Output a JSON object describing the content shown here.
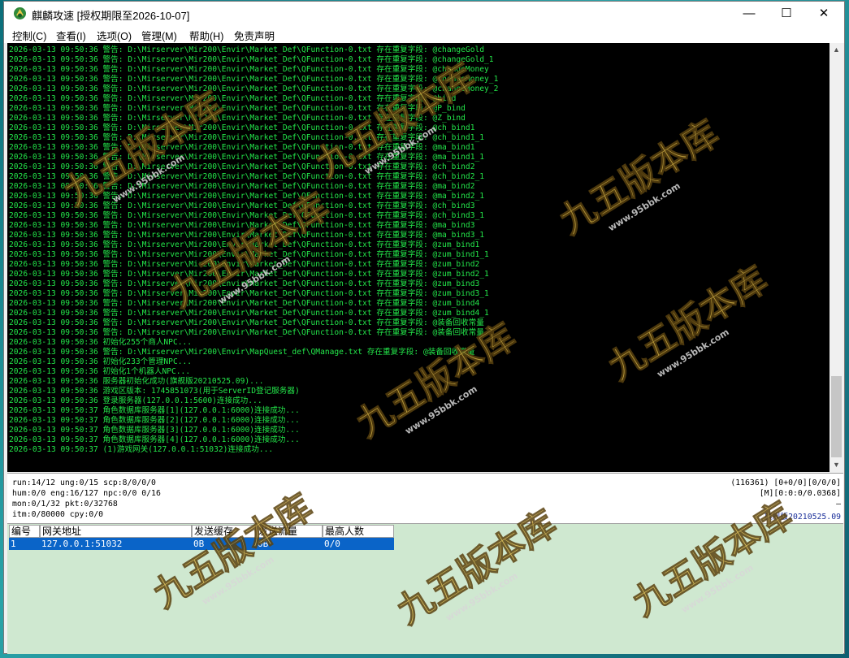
{
  "window": {
    "title": "麒麟攻速 [授权期限至2026-10-07]",
    "minimize_glyph": "—",
    "maximize_glyph": "☐",
    "close_glyph": "✕"
  },
  "menu": [
    "控制(C)",
    "查看(I)",
    "选项(O)",
    "管理(M)",
    "帮助(H)",
    "免责声明"
  ],
  "log": [
    "2026-03-13 09:50:36 警告: D:\\Mirserver\\Mir200\\Envir\\Market_Def\\QFunction-0.txt 存在重复字段: @changeGold",
    "2026-03-13 09:50:36 警告: D:\\Mirserver\\Mir200\\Envir\\Market_Def\\QFunction-0.txt 存在重复字段: @changeGold_1",
    "2026-03-13 09:50:36 警告: D:\\Mirserver\\Mir200\\Envir\\Market_Def\\QFunction-0.txt 存在重复字段: @changeMoney",
    "2026-03-13 09:50:36 警告: D:\\Mirserver\\Mir200\\Envir\\Market_Def\\QFunction-0.txt 存在重复字段: @changeMoney_1",
    "2026-03-13 09:50:36 警告: D:\\Mirserver\\Mir200\\Envir\\Market_Def\\QFunction-0.txt 存在重复字段: @changeMoney_2",
    "2026-03-13 09:50:36 警告: D:\\Mirserver\\Mir200\\Envir\\Market_Def\\QFunction-0.txt 存在重复字段: @bind",
    "2026-03-13 09:50:36 警告: D:\\Mirserver\\Mir200\\Envir\\Market_Def\\QFunction-0.txt 存在重复字段: @P_bind",
    "2026-03-13 09:50:36 警告: D:\\Mirserver\\Mir200\\Envir\\Market_Def\\QFunction-0.txt 存在重复字段: @Z_bind",
    "2026-03-13 09:50:36 警告: D:\\Mirserver\\Mir200\\Envir\\Market_Def\\QFunction-0.txt 存在重复字段: @ch_bind1",
    "2026-03-13 09:50:36 警告: D:\\Mirserver\\Mir200\\Envir\\Market_Def\\QFunction-0.txt 存在重复字段: @ch_bind1_1",
    "2026-03-13 09:50:36 警告: D:\\Mirserver\\Mir200\\Envir\\Market_Def\\QFunction-0.txt 存在重复字段: @ma_bind1",
    "2026-03-13 09:50:36 警告: D:\\Mirserver\\Mir200\\Envir\\Market_Def\\QFunction-0.txt 存在重复字段: @ma_bind1_1",
    "2026-03-13 09:50:36 警告: D:\\Mirserver\\Mir200\\Envir\\Market_Def\\QFunction-0.txt 存在重复字段: @ch_bind2",
    "2026-03-13 09:50:36 警告: D:\\Mirserver\\Mir200\\Envir\\Market_Def\\QFunction-0.txt 存在重复字段: @ch_bind2_1",
    "2026-03-13 09:50:36 警告: D:\\Mirserver\\Mir200\\Envir\\Market_Def\\QFunction-0.txt 存在重复字段: @ma_bind2",
    "2026-03-13 09:50:36 警告: D:\\Mirserver\\Mir200\\Envir\\Market_Def\\QFunction-0.txt 存在重复字段: @ma_bind2_1",
    "2026-03-13 09:50:36 警告: D:\\Mirserver\\Mir200\\Envir\\Market_Def\\QFunction-0.txt 存在重复字段: @ch_bind3",
    "2026-03-13 09:50:36 警告: D:\\Mirserver\\Mir200\\Envir\\Market_Def\\QFunction-0.txt 存在重复字段: @ch_bind3_1",
    "2026-03-13 09:50:36 警告: D:\\Mirserver\\Mir200\\Envir\\Market_Def\\QFunction-0.txt 存在重复字段: @ma_bind3",
    "2026-03-13 09:50:36 警告: D:\\Mirserver\\Mir200\\Envir\\Market_Def\\QFunction-0.txt 存在重复字段: @ma_bind3_1",
    "2026-03-13 09:50:36 警告: D:\\Mirserver\\Mir200\\Envir\\Market_Def\\QFunction-0.txt 存在重复字段: @zum_bind1",
    "2026-03-13 09:50:36 警告: D:\\Mirserver\\Mir200\\Envir\\Market_Def\\QFunction-0.txt 存在重复字段: @zum_bind1_1",
    "2026-03-13 09:50:36 警告: D:\\Mirserver\\Mir200\\Envir\\Market_Def\\QFunction-0.txt 存在重复字段: @zum_bind2",
    "2026-03-13 09:50:36 警告: D:\\Mirserver\\Mir200\\Envir\\Market_Def\\QFunction-0.txt 存在重复字段: @zum_bind2_1",
    "2026-03-13 09:50:36 警告: D:\\Mirserver\\Mir200\\Envir\\Market_Def\\QFunction-0.txt 存在重复字段: @zum_bind3",
    "2026-03-13 09:50:36 警告: D:\\Mirserver\\Mir200\\Envir\\Market_Def\\QFunction-0.txt 存在重复字段: @zum_bind3_1",
    "2026-03-13 09:50:36 警告: D:\\Mirserver\\Mir200\\Envir\\Market_Def\\QFunction-0.txt 存在重复字段: @zum_bind4",
    "2026-03-13 09:50:36 警告: D:\\Mirserver\\Mir200\\Envir\\Market_Def\\QFunction-0.txt 存在重复字段: @zum_bind4_1",
    "2026-03-13 09:50:36 警告: D:\\Mirserver\\Mir200\\Envir\\Market_Def\\QFunction-0.txt 存在重复字段: @装备回收常量",
    "2026-03-13 09:50:36 警告: D:\\Mirserver\\Mir200\\Envir\\Market_Def\\QFunction-0.txt 存在重复字段: @装备回收常量",
    "2026-03-13 09:50:36 初始化255个商人NPC...",
    "2026-03-13 09:50:36 警告: D:\\Mirserver\\Mir200\\Envir\\MapQuest_def\\QManage.txt 存在重复字段: @装备回收常量",
    "2026-03-13 09:50:36 初始化233个管理NPC...",
    "2026-03-13 09:50:36 初始化1个机器人NPC...",
    "2026-03-13 09:50:36 服务器初始化成功(旗舰版20210525.09)...",
    "2026-03-13 09:50:36 游戏区版本: 1745851073(用于ServerID登记服务器)",
    "2026-03-13 09:50:36 登录服务器(127.0.0.1:5600)连接成功...",
    "2026-03-13 09:50:37 角色数据库服务器[1](127.0.0.1:6000)连接成功...",
    "2026-03-13 09:50:37 角色数据库服务器[2](127.0.0.1:6000)连接成功...",
    "2026-03-13 09:50:37 角色数据库服务器[3](127.0.0.1:6000)连接成功...",
    "2026-03-13 09:50:37 角色数据库服务器[4](127.0.0.1:6000)连接成功...",
    "2026-03-13 09:50:37 (1)游戏网关(127.0.0.1:51032)连接成功..."
  ],
  "status": {
    "left": [
      "run:14/12 ung:0/15 scp:8/0/0/0",
      "hum:0/0 eng:16/127 npc:0/0 0/16",
      "mon:0/1/32 pkt:0/32768",
      "itm:0/80000 cpy:0/0"
    ],
    "right": [
      "(116361) [0+0/0][0/0/0]",
      "[M][0:0:0/0.0368]",
      "—",
      "旗舰版20210525.09"
    ],
    "version_color": "#1a2f9a"
  },
  "gateway": {
    "headers": [
      "编号",
      "网关地址",
      "发送缓存",
      "发送流量",
      "最高人数"
    ],
    "rows": [
      [
        "1",
        "127.0.0.1:51032",
        "0B",
        "0B",
        "0/0"
      ]
    ],
    "selected_color": "#0a64c8"
  },
  "watermark": {
    "text": "九五版本库",
    "url": "www.95bbk.com"
  },
  "colors": {
    "log_text": "#23e64a",
    "console_bg": "#000000",
    "gateway_bg": "#cfe8d0",
    "watermark_gold": "#d8b446"
  }
}
